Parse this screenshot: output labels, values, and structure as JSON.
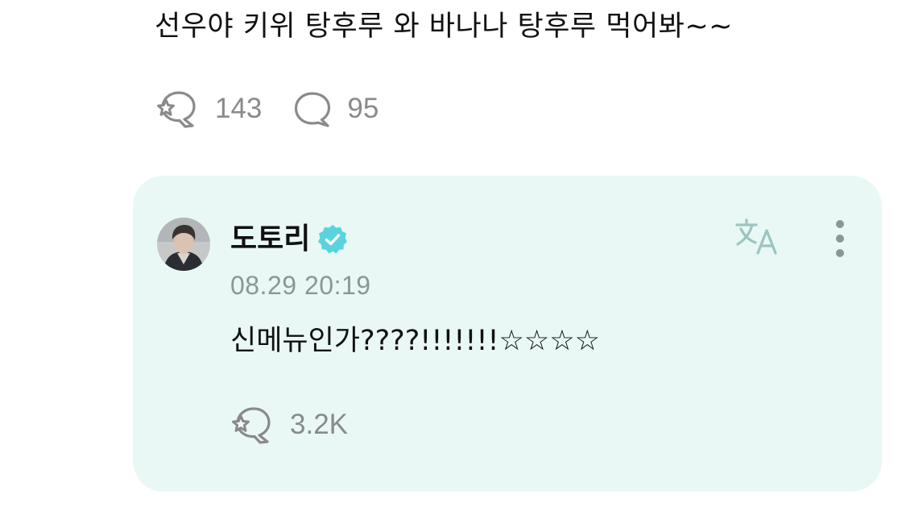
{
  "post": {
    "text": "선우야 키위 탕후루 와 바나나 탕후루 먹어봐~~",
    "likes": "143",
    "comments": "95"
  },
  "reply": {
    "author": "도토리",
    "verified": true,
    "timestamp": "08.29 20:19",
    "text": "신메뉴인가????!!!!!!!☆☆☆☆",
    "likes": "3.2K"
  },
  "icons": {
    "like": "star-bubble-like-icon",
    "comment": "speech-bubble-icon",
    "translate": "translate-icon",
    "more": "vertical-dots-more-icon",
    "verified": "verified-badge-icon"
  },
  "colors": {
    "background": "#ffffff",
    "reply_card": "#e9f8f5",
    "accent": "#4fd6e0",
    "icon_gray": "#8a8a8a",
    "translate_icon": "#9cc5c1",
    "timestamp": "#8c9695"
  }
}
